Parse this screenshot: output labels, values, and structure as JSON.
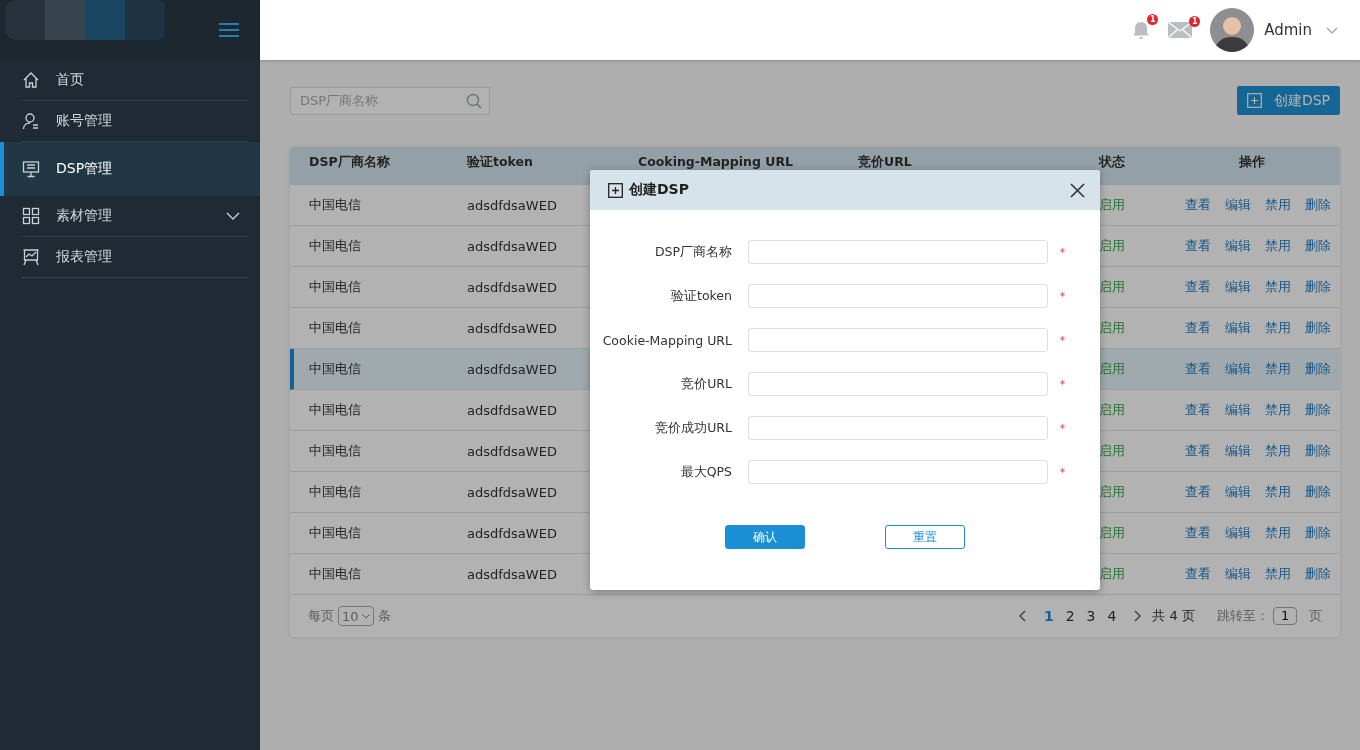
{
  "sidebar": {
    "items": [
      {
        "label": "首页",
        "selected": false,
        "expandable": false
      },
      {
        "label": "账号管理",
        "selected": false,
        "expandable": false
      },
      {
        "label": "DSP管理",
        "selected": true,
        "expandable": false
      },
      {
        "label": "素材管理",
        "selected": false,
        "expandable": true
      },
      {
        "label": "报表管理",
        "selected": false,
        "expandable": false
      }
    ]
  },
  "header": {
    "notifications": {
      "badge": "1"
    },
    "messages": {
      "badge": "1"
    },
    "user": {
      "name": "Admin"
    }
  },
  "toolbar": {
    "search": {
      "placeholder": "DSP厂商名称"
    },
    "create_button": "创建DSP"
  },
  "table": {
    "columns": [
      "DSP厂商名称",
      "验证token",
      "Cooking-Mapping URL",
      "竞价URL",
      "状态",
      "操作"
    ],
    "rows": [
      {
        "name": "中国电信",
        "token": "adsdfdsaWED",
        "status": "启用",
        "actions": [
          "查看",
          "编辑",
          "禁用",
          "删除"
        ],
        "selected": false
      },
      {
        "name": "中国电信",
        "token": "adsdfdsaWED",
        "status": "启用",
        "actions": [
          "查看",
          "编辑",
          "禁用",
          "删除"
        ],
        "selected": false
      },
      {
        "name": "中国电信",
        "token": "adsdfdsaWED",
        "status": "启用",
        "actions": [
          "查看",
          "编辑",
          "禁用",
          "删除"
        ],
        "selected": false
      },
      {
        "name": "中国电信",
        "token": "adsdfdsaWED",
        "status": "启用",
        "actions": [
          "查看",
          "编辑",
          "禁用",
          "删除"
        ],
        "selected": false
      },
      {
        "name": "中国电信",
        "token": "adsdfdsaWED",
        "status": "启用",
        "actions": [
          "查看",
          "编辑",
          "禁用",
          "删除"
        ],
        "selected": true
      },
      {
        "name": "中国电信",
        "token": "adsdfdsaWED",
        "status": "启用",
        "actions": [
          "查看",
          "编辑",
          "禁用",
          "删除"
        ],
        "selected": false
      },
      {
        "name": "中国电信",
        "token": "adsdfdsaWED",
        "status": "启用",
        "actions": [
          "查看",
          "编辑",
          "禁用",
          "删除"
        ],
        "selected": false
      },
      {
        "name": "中国电信",
        "token": "adsdfdsaWED",
        "status": "启用",
        "actions": [
          "查看",
          "编辑",
          "禁用",
          "删除"
        ],
        "selected": false
      },
      {
        "name": "中国电信",
        "token": "adsdfdsaWED",
        "status": "启用",
        "actions": [
          "查看",
          "编辑",
          "禁用",
          "删除"
        ],
        "selected": false
      },
      {
        "name": "中国电信",
        "token": "adsdfdsaWED",
        "status": "启用",
        "actions": [
          "查看",
          "编辑",
          "禁用",
          "删除"
        ],
        "selected": false
      }
    ]
  },
  "pagination": {
    "per_page_label": "每页",
    "per_page": "10",
    "per_page_unit": "条",
    "pages": [
      {
        "label": "1",
        "selected": true
      },
      {
        "label": "2",
        "selected": false
      },
      {
        "label": "3",
        "selected": false
      },
      {
        "label": "4",
        "selected": false
      }
    ],
    "total": "共 4 页",
    "jump_label": "跳转至：",
    "jump_value": "1",
    "jump_unit": "页"
  },
  "dialog": {
    "title": "创建DSP",
    "fields": [
      {
        "label": "DSP厂商名称",
        "required_mark": "*"
      },
      {
        "label": "验证token",
        "required_mark": "*"
      },
      {
        "label": "Cookie-Mapping URL",
        "required_mark": "*"
      },
      {
        "label": "竞价URL",
        "required_mark": "*"
      },
      {
        "label": "竞价成功URL",
        "required_mark": "*"
      },
      {
        "label": "最大QPS",
        "required_mark": "*"
      }
    ],
    "buttons": [
      {
        "label": "确认",
        "kind": "primary"
      },
      {
        "label": "重置",
        "kind": "secondary"
      }
    ]
  }
}
